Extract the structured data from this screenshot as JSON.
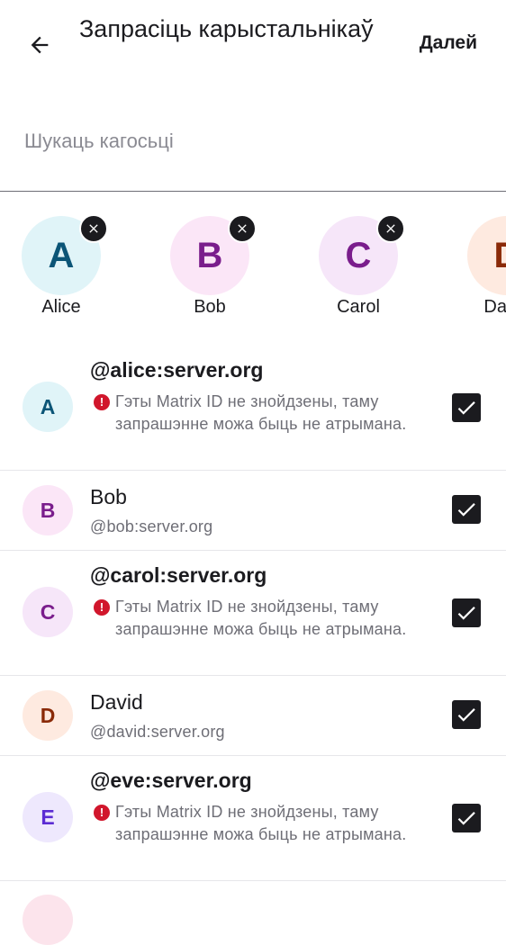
{
  "topbar": {
    "title": "Запрасіць карыстальнікаў",
    "next_label": "Далей"
  },
  "search": {
    "placeholder": "Шукаць кагосьці"
  },
  "selected_chips": [
    {
      "initial": "A",
      "name": "Alice",
      "bg": "#e0f4f8",
      "fg": "#0b5577"
    },
    {
      "initial": "B",
      "name": "Bob",
      "bg": "#fbe6f7",
      "fg": "#7a1d8c"
    },
    {
      "initial": "C",
      "name": "Carol",
      "bg": "#f6e6f9",
      "fg": "#7a1d8c"
    },
    {
      "initial": "D",
      "name": "David",
      "bg": "#feeae0",
      "fg": "#8a2a08"
    }
  ],
  "users": [
    {
      "initial": "A",
      "primary": "@alice:server.org",
      "warning": "Гэты Matrix ID не знойдзены, таму запрашэнне можа быць не атрымана.",
      "checked": true,
      "bg": "#e0f4f8",
      "fg": "#0b5577"
    },
    {
      "initial": "B",
      "primary": "Bob",
      "secondary": "@bob:server.org",
      "checked": true,
      "bg": "#fbe6f7",
      "fg": "#7a1d8c"
    },
    {
      "initial": "C",
      "primary": "@carol:server.org",
      "warning": "Гэты Matrix ID не знойдзены, таму запрашэнне можа быць не атрымана.",
      "checked": true,
      "bg": "#f6e6f9",
      "fg": "#7a1d8c"
    },
    {
      "initial": "D",
      "primary": "David",
      "secondary": "@david:server.org",
      "checked": true,
      "bg": "#feeae0",
      "fg": "#8a2a08"
    },
    {
      "initial": "E",
      "primary": "@eve:server.org",
      "warning": "Гэты Matrix ID не знойдзены, таму запрашэнне можа быць не атрымана.",
      "checked": true,
      "bg": "#eee8fd",
      "fg": "#5b2bd3"
    }
  ]
}
